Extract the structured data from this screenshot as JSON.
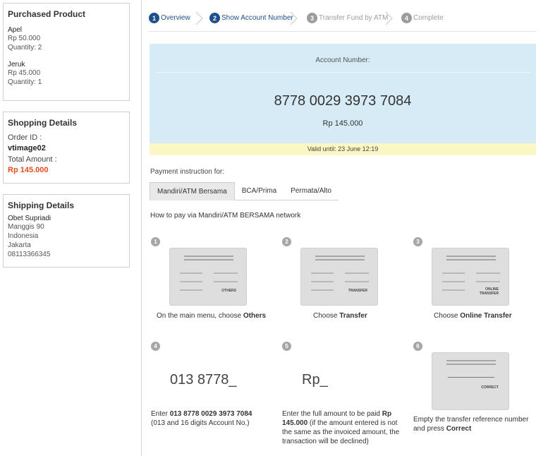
{
  "purchased": {
    "title": "Purchased Product",
    "items": [
      {
        "name": "Apel",
        "price": "Rp 50.000",
        "quantity": "Quantity: 2"
      },
      {
        "name": "Jeruk",
        "price": "Rp 45.000",
        "quantity": "Quantity: 1"
      }
    ]
  },
  "shopping": {
    "title": "Shopping Details",
    "order_label": "Order ID :",
    "order_id": "vtimage02",
    "total_label": "Total Amount :",
    "total": "Rp 145.000"
  },
  "shipping": {
    "title": "Shipping Details",
    "name": "Obet Supriadi",
    "address": [
      "Manggis 90",
      "Indonesia",
      "Jakarta",
      "08113366345"
    ]
  },
  "steps": [
    {
      "num": "1",
      "label": "Overview",
      "state": "active"
    },
    {
      "num": "2",
      "label": "Show Account Number",
      "state": "active"
    },
    {
      "num": "3",
      "label": "Transfer Fund by ATM",
      "state": "inactive"
    },
    {
      "num": "4",
      "label": "Complete",
      "state": "inactive"
    }
  ],
  "account": {
    "label": "Account Number:",
    "number": "8778 0029 3973 7084",
    "amount": "Rp 145.000",
    "valid_until": "Valid until: 23 June 12:19"
  },
  "payment": {
    "instruction_for": "Payment instruction for:",
    "tabs": [
      "Mandiri/ATM Bersama",
      "BCA/Prima",
      "Permata/Alto"
    ],
    "selected_tab": "Mandiri/ATM Bersama",
    "how_to": "How to pay via Mandiri/ATM BERSAMA network"
  },
  "instructions": [
    {
      "num": "1",
      "screen_key": "OTHERS",
      "caption_pre": "On the main menu, choose ",
      "caption_bold": "Others"
    },
    {
      "num": "2",
      "screen_key": "TRANSFER",
      "caption_pre": "Choose ",
      "caption_bold": "Transfer"
    },
    {
      "num": "3",
      "screen_key_line1": "ONLINE",
      "screen_key_line2": "TRANSFER",
      "caption_pre": "Choose ",
      "caption_bold": "Online Transfer"
    },
    {
      "num": "4",
      "display": "013 8778_",
      "caption_pre": "Enter ",
      "caption_bold": "013 8778 0029 3973 7084",
      "caption_post": "(013 and 16 digits Account No.)"
    },
    {
      "num": "5",
      "display": "Rp_",
      "caption_pre": "Enter the full amount to be paid ",
      "caption_bold": "Rp 145.000",
      "caption_post": " (if the amount entered is not the same as the invoiced amount, the transaction will be declined)"
    },
    {
      "num": "6",
      "screen_key": "CORRECT",
      "caption_pre": "Empty the transfer reference number and press ",
      "caption_bold": "Correct"
    }
  ],
  "colors": {
    "accent": "#1c4f8c",
    "total": "#e14d1f",
    "account_bg": "#d6ebf5",
    "valid_bg": "#fbf7c4"
  }
}
